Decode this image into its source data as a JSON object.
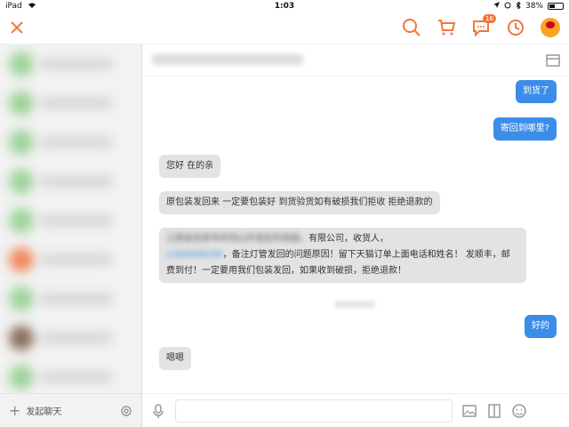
{
  "status_bar": {
    "device": "iPad",
    "time": "1:03",
    "battery": "38%"
  },
  "topbar": {
    "message_badge": "16"
  },
  "sidebar": {
    "start_chat_label": "发起聊天"
  },
  "messages": [
    {
      "direction": "out",
      "text": "到货了"
    },
    {
      "direction": "out",
      "text": "寄回到哪里?"
    },
    {
      "direction": "in",
      "text": "您好  在的亲"
    },
    {
      "direction": "in",
      "text": "原包装发回来 一定要包装好 到货验货如有破损我们拒收 拒绝退款的"
    },
    {
      "direction": "in",
      "line1_suffix": "有限公司，收货人，",
      "line2_suffix": "，备注灯管发回的问题原因！留下天猫订单上面电话和姓名！ 发顺丰，邮",
      "line3": "费到付！一定要用我们包装发回，如果收到破损，拒绝退款！"
    },
    {
      "direction": "out",
      "text": "好的"
    },
    {
      "direction": "in",
      "text": "嗯嗯"
    }
  ],
  "colors": {
    "accent": "#f5753c",
    "outgoing_bubble": "#3b8de8",
    "incoming_bubble": "#e3e3e3"
  }
}
